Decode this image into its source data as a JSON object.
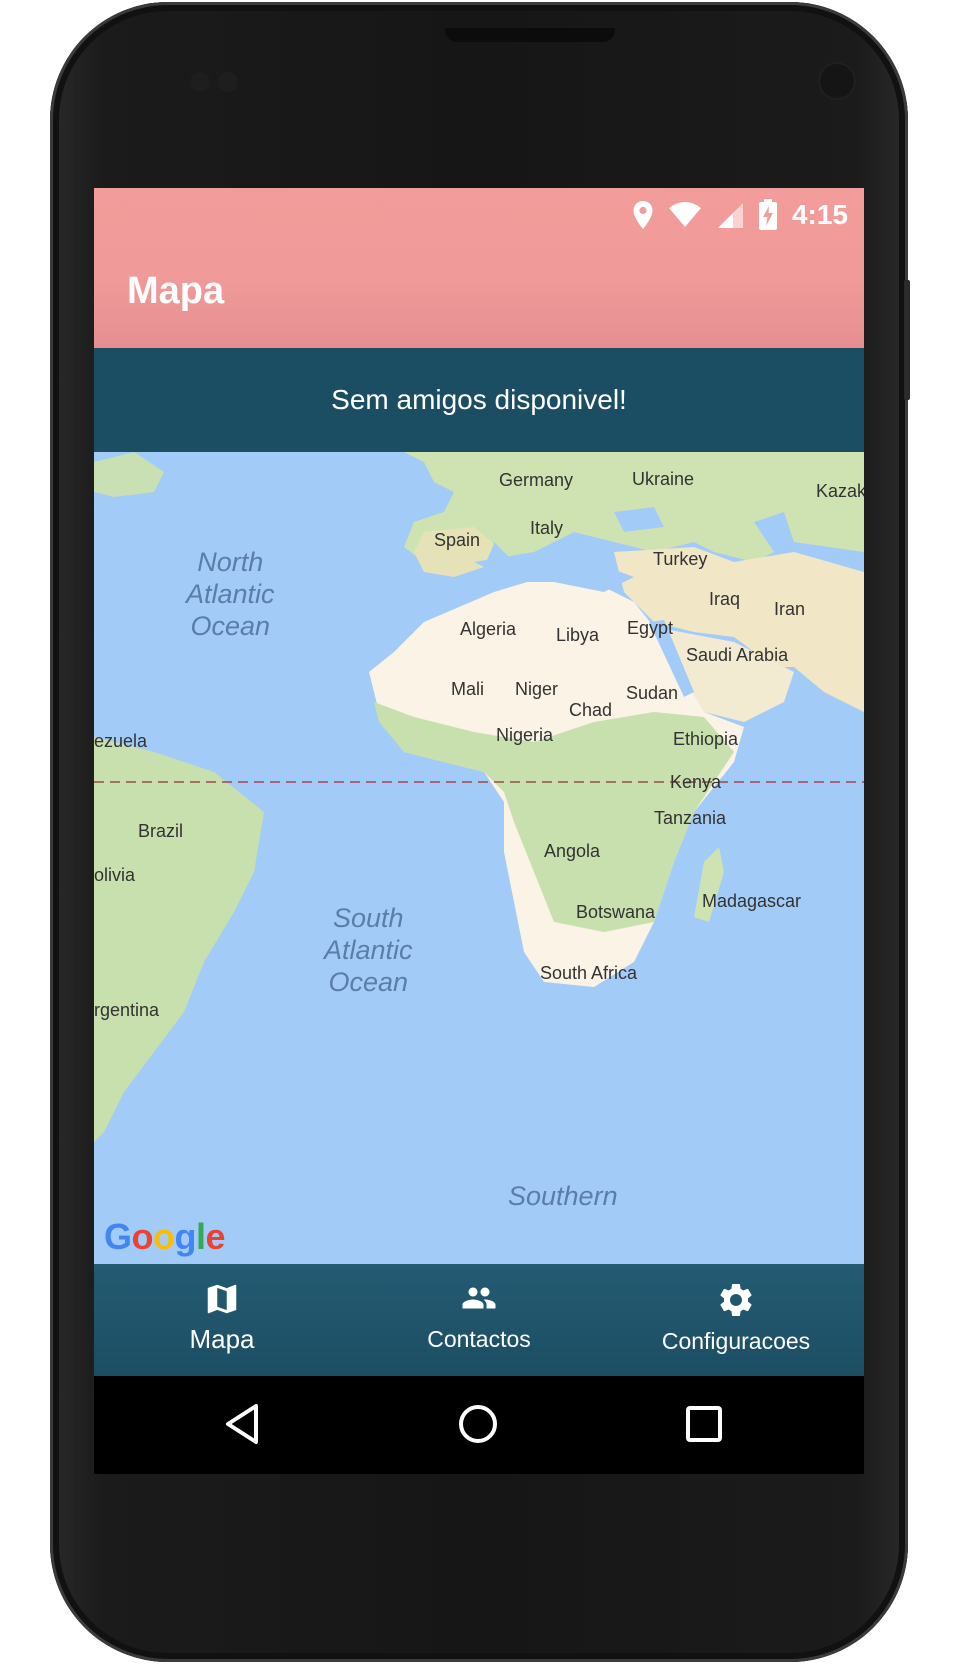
{
  "status_bar": {
    "time": "4:15",
    "icons": [
      "location-icon",
      "wifi-icon",
      "signal-icon",
      "battery-charging-icon"
    ]
  },
  "app_bar": {
    "title": "Mapa"
  },
  "banner": {
    "text": "Sem amigos disponivel!"
  },
  "map": {
    "oceans": {
      "north_atlantic": "North\nAtlantic\nOcean",
      "south_atlantic": "South\nAtlantic\nOcean",
      "southern": "Southern"
    },
    "countries": {
      "germany": "Germany",
      "ukraine": "Ukraine",
      "kazak": "Kazak",
      "spain": "Spain",
      "italy": "Italy",
      "turkey": "Turkey",
      "iraq": "Iraq",
      "iran": "Iran",
      "algeria": "Algeria",
      "libya": "Libya",
      "egypt": "Egypt",
      "saudi_arabia": "Saudi Arabia",
      "mali": "Mali",
      "niger": "Niger",
      "chad": "Chad",
      "sudan": "Sudan",
      "nigeria": "Nigeria",
      "ethiopia": "Ethiopia",
      "venezuela": "ezuela",
      "kenya": "Kenya",
      "brazil": "Brazil",
      "tanzania": "Tanzania",
      "angola": "Angola",
      "bolivia": "olivia",
      "madagascar": "Madagascar",
      "botswana": "Botswana",
      "south_africa": "South Africa",
      "argentina": "rgentina"
    },
    "attribution": "Google"
  },
  "bottom_nav": {
    "items": [
      {
        "label": "Mapa",
        "icon": "map-icon",
        "active": true
      },
      {
        "label": "Contactos",
        "icon": "people-icon",
        "active": false
      },
      {
        "label": "Configuracoes",
        "icon": "gear-icon",
        "active": false
      }
    ]
  },
  "system_nav": {
    "buttons": [
      "back-icon",
      "home-icon",
      "recents-icon"
    ]
  }
}
